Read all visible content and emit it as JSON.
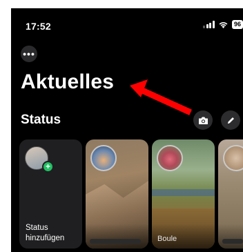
{
  "status_bar": {
    "time": "17:52",
    "battery": "96"
  },
  "icons": {
    "more": "more-horizontal-icon",
    "camera": "camera-icon",
    "edit": "pencil-icon",
    "wifi": "wifi-icon",
    "signal": "cellular-signal-icon",
    "annotation_arrow": "red-arrow-icon"
  },
  "header": {
    "more_label": "•••",
    "title": "Aktuelles"
  },
  "status_section": {
    "title": "Status",
    "add_card_label": "Status hinzufügen",
    "add_badge": "+",
    "cards": [
      {
        "name": ""
      },
      {
        "name": "Boule"
      },
      {
        "name": ""
      }
    ]
  },
  "colors": {
    "background": "#000000",
    "accent_green": "#21c063",
    "annotation_red": "#ff0000"
  }
}
